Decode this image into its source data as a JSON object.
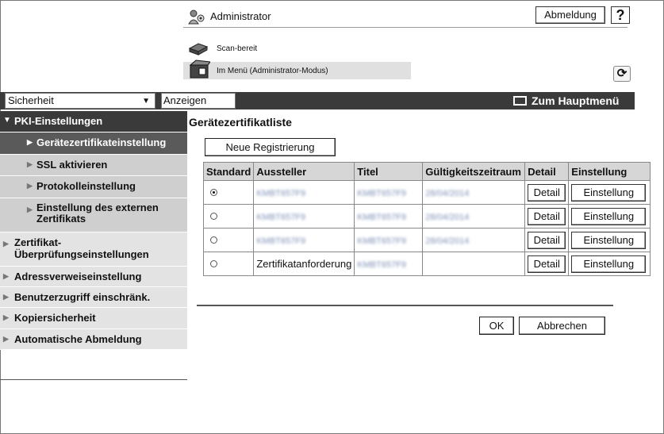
{
  "header": {
    "user_label": "Administrator",
    "logout_label": "Abmeldung",
    "help_label": "?",
    "status_scan": "Scan-bereit",
    "status_mode": "Im Menü (Administrator-Modus)",
    "refresh_icon": "refresh-icon"
  },
  "toolbar": {
    "category_value": "Sicherheit",
    "show_label": "Anzeigen",
    "home_label": "Zum Hauptmenü"
  },
  "sidebar": {
    "items": [
      {
        "label": "PKI-Einstellungen"
      },
      {
        "label": "Gerätezertifikateinstellung"
      },
      {
        "label": "SSL aktivieren"
      },
      {
        "label": "Protokolleinstellung"
      },
      {
        "label": "Einstellung des externen Zertifikats"
      },
      {
        "label": "Zertifikat-Überprüfungseinstellungen"
      },
      {
        "label": "Adressverweiseinstellung"
      },
      {
        "label": "Benutzerzugriff einschränk."
      },
      {
        "label": "Kopiersicherheit"
      },
      {
        "label": "Automatische Abmeldung"
      }
    ]
  },
  "main": {
    "title": "Gerätezertifikatliste",
    "new_registration_label": "Neue Registrierung",
    "table": {
      "headers": [
        "Standard",
        "Aussteller",
        "Titel",
        "Gültigkeitszeitraum",
        "Detail",
        "Einstellung"
      ],
      "rows": [
        {
          "selected": true,
          "issuer": "KMBT657F9",
          "title": "KMBT657F9",
          "validity": "28/04/2014",
          "detail_label": "Detail",
          "setting_label": "Einstellung"
        },
        {
          "selected": false,
          "issuer": "KMBT657F9",
          "title": "KMBT657F9",
          "validity": "28/04/2014",
          "detail_label": "Detail",
          "setting_label": "Einstellung"
        },
        {
          "selected": false,
          "issuer": "KMBT657F9",
          "title": "KMBT657F9",
          "validity": "28/04/2014",
          "detail_label": "Detail",
          "setting_label": "Einstellung"
        },
        {
          "selected": false,
          "issuer": "Zertifikatanforderung",
          "title": "KMBT657F9",
          "validity": "",
          "detail_label": "Detail",
          "setting_label": "Einstellung"
        }
      ]
    },
    "ok_label": "OK",
    "cancel_label": "Abbrechen"
  },
  "colors": {
    "toolbar_bg": "#3a3a3a",
    "nav_open_bg": "#3a3a3a",
    "nav_active_bg": "#5a5a5a",
    "nav_level1_bg": "#e3e3e3",
    "nav_sub_bg": "#cfcfcf",
    "table_header_bg": "#d6d6d6"
  }
}
